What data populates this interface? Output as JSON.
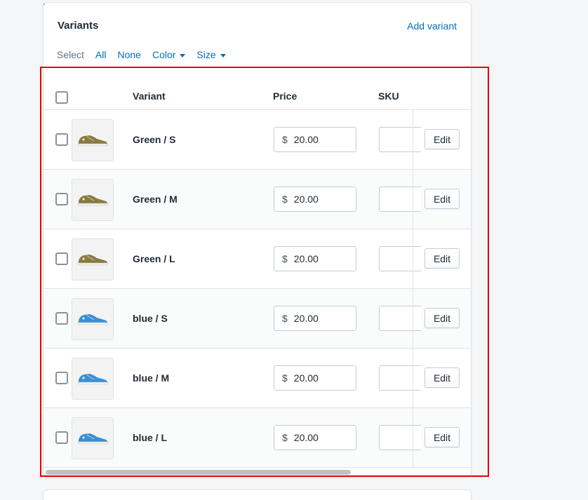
{
  "card": {
    "title": "Variants",
    "add_variant_label": "Add variant"
  },
  "select_bar": {
    "label": "Select",
    "all": "All",
    "none": "None",
    "color": "Color",
    "size": "Size"
  },
  "table": {
    "headers": {
      "variant": "Variant",
      "price": "Price",
      "sku": "SKU"
    },
    "rows": [
      {
        "name": "Green / S",
        "currency": "$",
        "price": "20.00",
        "sku": "",
        "edit": "Edit",
        "shoe_color": "#8a7a3e"
      },
      {
        "name": "Green / M",
        "currency": "$",
        "price": "20.00",
        "sku": "",
        "edit": "Edit",
        "shoe_color": "#8a7a3e"
      },
      {
        "name": "Green / L",
        "currency": "$",
        "price": "20.00",
        "sku": "",
        "edit": "Edit",
        "shoe_color": "#8a7a3e"
      },
      {
        "name": "blue / S",
        "currency": "$",
        "price": "20.00",
        "sku": "",
        "edit": "Edit",
        "shoe_color": "#3b8fd4"
      },
      {
        "name": "blue / M",
        "currency": "$",
        "price": "20.00",
        "sku": "",
        "edit": "Edit",
        "shoe_color": "#3b8fd4"
      },
      {
        "name": "blue / L",
        "currency": "$",
        "price": "20.00",
        "sku": "",
        "edit": "Edit",
        "shoe_color": "#3b8fd4"
      }
    ]
  },
  "colors": {
    "link": "#006fbb",
    "highlight": "#e60000",
    "background": "#f4f6f8"
  }
}
